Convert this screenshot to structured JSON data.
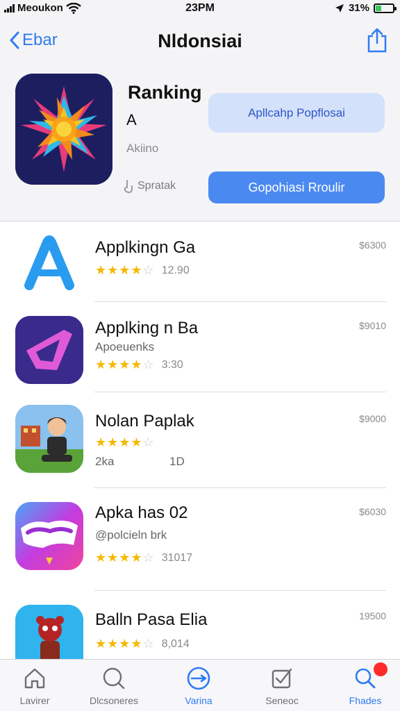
{
  "status_bar": {
    "carrier": "Meoukon",
    "time": "23PM",
    "battery": "31%",
    "battery_level": 0.31,
    "battery_color": "#34c759"
  },
  "nav": {
    "back_label": "Ebar",
    "title": "Nldonsiai",
    "share_icon": "share-icon"
  },
  "hero": {
    "title": "Ranking",
    "subtitle": "A",
    "developer": "Akiino",
    "rating_text": "Spratak",
    "secondary_button": "Apllcahp Popflosai",
    "primary_button": "Gopohiasi Rroulir",
    "accent_color": "#4a89f0"
  },
  "apps": [
    {
      "name": "Applkingn Ga",
      "developer": "",
      "rating": 4,
      "rating_count": "12.90",
      "extra": "",
      "price": "$6300"
    },
    {
      "name": "Applking n Ba",
      "developer": "Apoeuenks",
      "rating": 4,
      "rating_count": "3:30",
      "extra": "",
      "price": "$9010"
    },
    {
      "name": "Nolan Paplak",
      "developer": "",
      "rating": 4,
      "rating_count": "2ka",
      "extra": "1D",
      "price": "$9000"
    },
    {
      "name": "Apka has 02",
      "developer": "@polcieln brk",
      "rating": 4,
      "rating_count": "31017",
      "extra": "",
      "price": "$6030"
    },
    {
      "name": "Balln Pasa Elia",
      "developer": "",
      "rating": 4,
      "rating_count": "8,014",
      "extra": "",
      "price": "19500"
    }
  ],
  "tabs": [
    {
      "label": "Lavirer",
      "icon": "house-icon",
      "active": false
    },
    {
      "label": "Dlcsoneres",
      "icon": "search-circle-icon",
      "active": false
    },
    {
      "label": "Varina",
      "icon": "compass-icon",
      "active": true
    },
    {
      "label": "Seneoc",
      "icon": "checkbox-icon",
      "active": false
    },
    {
      "label": "Fhades",
      "icon": "magnifier-icon",
      "active": true,
      "badge": true
    }
  ]
}
